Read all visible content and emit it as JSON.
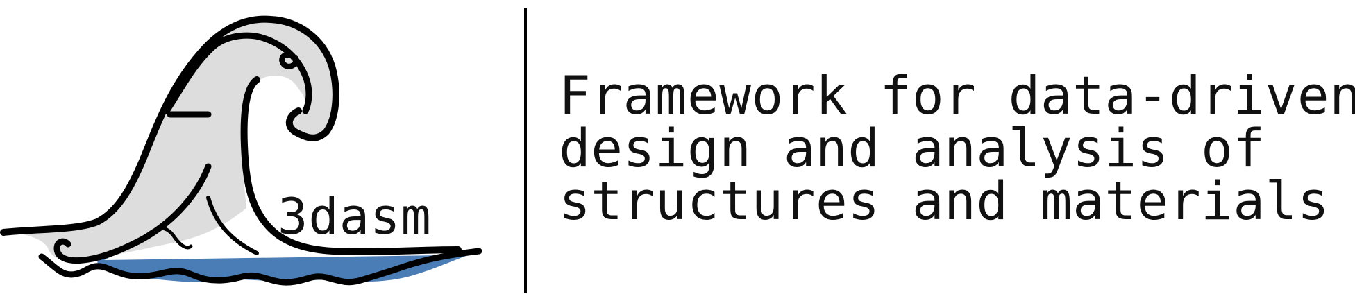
{
  "logo": {
    "brand": "3dasm",
    "colors": {
      "wave_fill": "#dddddd",
      "water_fill": "#4a7cb5",
      "outline": "#000000"
    }
  },
  "tagline": {
    "lines": [
      "Framework for data-driven",
      "design and analysis of",
      "structures and materials"
    ]
  }
}
